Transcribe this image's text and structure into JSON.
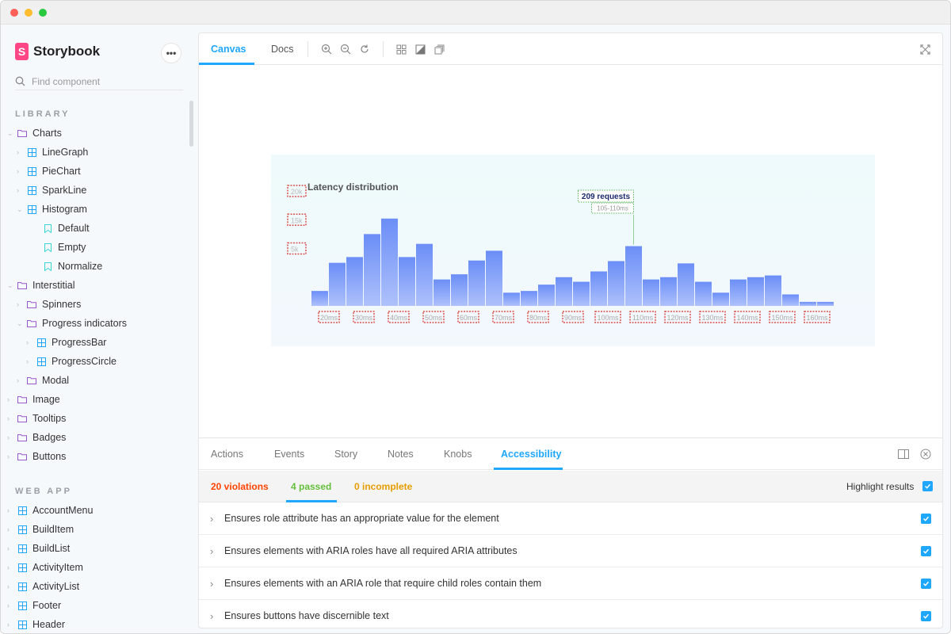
{
  "app": {
    "brand": "Storybook",
    "search_placeholder": "Find component"
  },
  "sidebar": {
    "library_title": "LIBRARY",
    "webapp_title": "WEB APP",
    "library_items": [
      {
        "label": "Charts",
        "kind": "folder",
        "expanded": true
      },
      {
        "label": "LineGraph",
        "kind": "component"
      },
      {
        "label": "PieChart",
        "kind": "component"
      },
      {
        "label": "SparkLine",
        "kind": "component"
      },
      {
        "label": "Histogram",
        "kind": "component",
        "expanded": true
      },
      {
        "label": "Default",
        "kind": "story"
      },
      {
        "label": "Empty",
        "kind": "story"
      },
      {
        "label": "Normalize",
        "kind": "story"
      },
      {
        "label": "Interstitial",
        "kind": "folder",
        "expanded": true
      },
      {
        "label": "Spinners",
        "kind": "folder"
      },
      {
        "label": "Progress indicators",
        "kind": "folder",
        "expanded": true
      },
      {
        "label": "ProgressBar",
        "kind": "component"
      },
      {
        "label": "ProgressCircle",
        "kind": "component"
      },
      {
        "label": "Modal",
        "kind": "folder"
      },
      {
        "label": "Image",
        "kind": "folder"
      },
      {
        "label": "Tooltips",
        "kind": "folder"
      },
      {
        "label": "Badges",
        "kind": "folder"
      },
      {
        "label": "Buttons",
        "kind": "folder"
      }
    ],
    "webapp_items": [
      {
        "label": "AccountMenu",
        "kind": "component"
      },
      {
        "label": "BuildItem",
        "kind": "component"
      },
      {
        "label": "BuildList",
        "kind": "component"
      },
      {
        "label": "ActivityItem",
        "kind": "component"
      },
      {
        "label": "ActivityList",
        "kind": "component"
      },
      {
        "label": "Footer",
        "kind": "component"
      },
      {
        "label": "Header",
        "kind": "component"
      }
    ]
  },
  "toolbar": {
    "tabs": [
      "Canvas",
      "Docs"
    ],
    "active_tab": "Canvas"
  },
  "chart_data": {
    "type": "bar",
    "title": "Latency distribution",
    "x_tick_labels": [
      "20ms",
      "30ms",
      "40ms",
      "50ms",
      "60ms",
      "70ms",
      "80ms",
      "90ms",
      "100ms",
      "110ms",
      "120ms",
      "130ms",
      "140ms",
      "150ms",
      "160ms"
    ],
    "y_tick_labels": [
      "20k",
      "15k",
      "5k"
    ],
    "bin_width_ms": 5,
    "x_start_ms": 15,
    "values": [
      2600,
      7500,
      8500,
      12500,
      15200,
      8500,
      10800,
      4600,
      5500,
      7900,
      9600,
      2300,
      2600,
      3700,
      5000,
      4200,
      6000,
      7800,
      10400,
      4600,
      5000,
      7400,
      4200,
      2300,
      4600,
      5000,
      5300,
      2000,
      700,
      700
    ],
    "ylim": [
      0,
      20000
    ],
    "tooltip": {
      "value_label": "209 requests",
      "range_label": "105-110ms"
    },
    "highlight_index": 18,
    "bar_color_top": "#6b8ef7",
    "bar_color_bottom": "#aec1fb",
    "violation_outline_color": "#d9534f"
  },
  "addons": {
    "tabs": [
      "Actions",
      "Events",
      "Story",
      "Notes",
      "Knobs",
      "Accessibility"
    ],
    "active_tab": "Accessibility",
    "violations": "20 violations",
    "passed": "4 passed",
    "incomplete": "0 incomplete",
    "highlight_label": "Highlight results",
    "rules": [
      "Ensures role attribute has an appropriate value for the element",
      "Ensures elements with ARIA roles have all required ARIA attributes",
      "Ensures elements with an ARIA role that require child roles contain them",
      "Ensures buttons have discernible text"
    ],
    "colors": {
      "violation": "#ff4400",
      "passed": "#66bf3c",
      "incomplete": "#e69d00",
      "accent": "#1ea7fd"
    }
  }
}
